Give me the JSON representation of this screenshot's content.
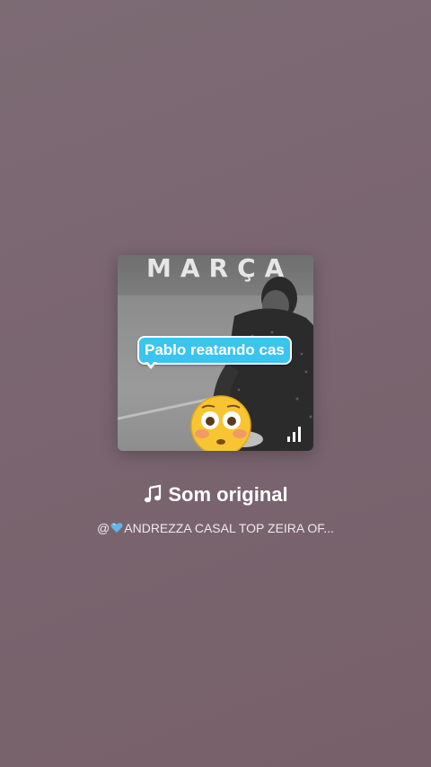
{
  "audio": {
    "title": "Som original",
    "author_prefix": "@",
    "author_name": "ANDREZZA CASAL TOP ZEIRA  OF...",
    "music_icon": "music-note-icon",
    "author_icon": "blue-heart-icon"
  },
  "cover": {
    "wall_text": "MARÇA",
    "caption": "Pablo reatando cas",
    "emoji": "flushed-face-icon",
    "overlay_icon": "audio-bars-icon"
  },
  "colors": {
    "background": "#7a6570",
    "caption_bubble": "#3ac4ef",
    "text": "#ffffff"
  }
}
